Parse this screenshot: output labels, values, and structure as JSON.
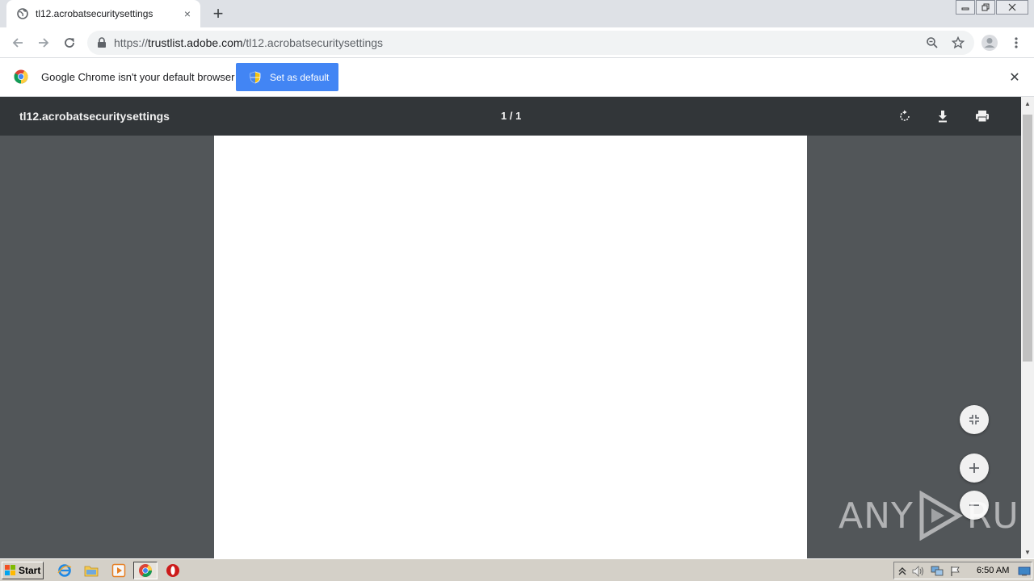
{
  "browser": {
    "tab": {
      "title": "tl12.acrobatsecuritysettings",
      "close_icon": "×"
    },
    "newtab_icon": "+",
    "window_controls": [
      "minimize-icon",
      "restore-icon",
      "close-icon"
    ]
  },
  "toolbar": {
    "url_scheme": "https://",
    "url_host": "trustlist.adobe.com",
    "url_path": "/tl12.acrobatsecuritysettings"
  },
  "infobar": {
    "message": "Google Chrome isn't your default browser",
    "button_label": "Set as default",
    "close_icon": "✕"
  },
  "pdf": {
    "title": "tl12.acrobatsecuritysettings",
    "page_indicator": "1 / 1",
    "tools": [
      "rotate-icon",
      "download-icon",
      "print-icon"
    ],
    "fabs": [
      "fit-page-icon",
      "zoom-in-icon",
      "zoom-out-icon"
    ]
  },
  "watermark": {
    "left": "ANY",
    "right": "RUN"
  },
  "taskbar": {
    "start_label": "Start",
    "apps": [
      "ie-icon",
      "explorer-icon",
      "media-player-icon",
      "chrome-icon",
      "opera-icon"
    ],
    "clock": "6:50 AM"
  },
  "colors": {
    "accent": "#4285f4",
    "pdf_toolbar": "#323639",
    "pdf_background": "#525659"
  }
}
